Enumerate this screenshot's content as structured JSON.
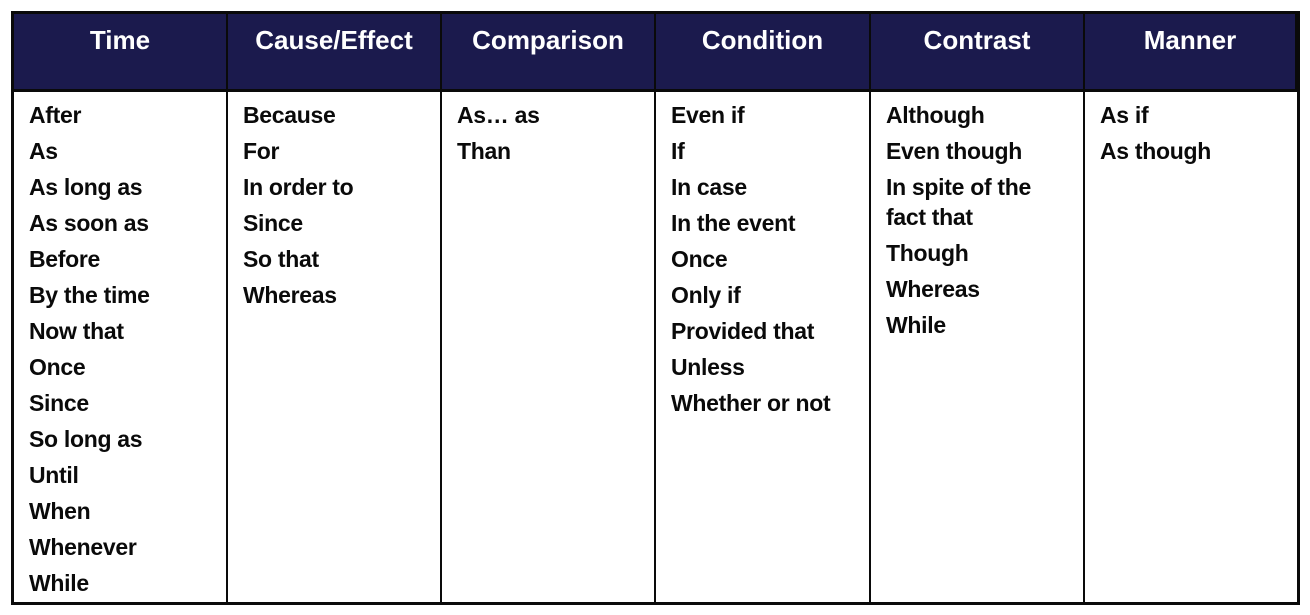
{
  "table": {
    "header_color": "#1b1a4d",
    "columns": [
      {
        "header": "Time",
        "items": [
          "After",
          "As",
          "As long as",
          "As soon as",
          "Before",
          "By the time",
          "Now that",
          "Once",
          "Since",
          "So long as",
          "Until",
          "When",
          "Whenever",
          "While"
        ]
      },
      {
        "header": "Cause/Effect",
        "items": [
          "Because",
          "For",
          "In order to",
          "Since",
          "So that",
          "Whereas"
        ]
      },
      {
        "header": "Comparison",
        "items": [
          "As… as",
          "Than"
        ]
      },
      {
        "header": "Condition",
        "items": [
          "Even if",
          "If",
          "In case",
          "In the event",
          "Once",
          "Only if",
          "Provided that",
          "Unless",
          "Whether or not"
        ]
      },
      {
        "header": "Contrast",
        "items": [
          "Although",
          "Even though",
          "In spite of the fact that",
          "Though",
          "Whereas",
          "While"
        ]
      },
      {
        "header": "Manner",
        "items": [
          "As if",
          "As though"
        ]
      }
    ]
  }
}
